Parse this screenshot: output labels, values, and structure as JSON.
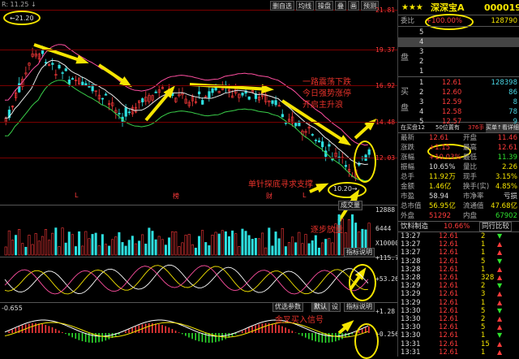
{
  "stock": {
    "stars": "★★★",
    "name": "深深宝A",
    "code": "000019"
  },
  "top_left": {
    "indicator_label": "R: 11.25 ↓",
    "high_marker": "←21.20"
  },
  "toolbar": [
    "删自选",
    "均线",
    "操盘",
    "叠",
    "画",
    "预测"
  ],
  "price_axis": [
    "21.81",
    "19.37",
    "16.92",
    "14.48",
    "12.03"
  ],
  "price_axis_right": [
    "21.81",
    "19.37",
    "16.92",
    "14.48",
    "12.03"
  ],
  "low_marker": "10.20→",
  "chart_tags": [
    "L",
    "榜",
    "财",
    "L"
  ],
  "chart_tools": {
    "composite": "成交量",
    "indicator_help_1": "指标说明",
    "indicator_help_2": "指标说明",
    "optimize": "优选参数",
    "default": "默认",
    "tool3": "设"
  },
  "vol_axis": [
    "12888",
    "6444",
    "X10000"
  ],
  "osc_axis": [
    "+115.7",
    "+53.26",
    "-9.213"
  ],
  "macd_axis": [
    "+1.28",
    "+0.256"
  ],
  "macd_left": "-0.655",
  "annotations": {
    "a1": "一路震荡下跌",
    "a2": "今日强势涨停",
    "a3": "开启主升浪",
    "a4": "单针探底寻求支撑",
    "a5": "逐步放量",
    "a6": "金叉买入信号"
  },
  "panel": {
    "weibi": {
      "label": "委比",
      "value": "+100.00%",
      "vol": "128790"
    },
    "sell": [
      {
        "n": "5",
        "p": "",
        "v": ""
      },
      {
        "n": "4",
        "p": "",
        "v": ""
      },
      {
        "n": "3",
        "p": "",
        "v": ""
      },
      {
        "n": "2",
        "p": "",
        "v": ""
      },
      {
        "n": "1",
        "p": "",
        "v": ""
      }
    ],
    "sell_side_label": [
      "卖",
      "盘"
    ],
    "buy": [
      {
        "n": "1",
        "p": "12.61",
        "v": "128398"
      },
      {
        "n": "2",
        "p": "12.60",
        "v": "86"
      },
      {
        "n": "3",
        "p": "12.59",
        "v": "8"
      },
      {
        "n": "4",
        "p": "12.58",
        "v": "78"
      },
      {
        "n": "5",
        "p": "12.57",
        "v": "9"
      }
    ],
    "buy_side_label": [
      "买",
      "盘"
    ],
    "tabs": {
      "t1": "在买盘12",
      "t2": "50位置有",
      "t3": "376手",
      "t4": "买单↑看详细"
    },
    "stats_left": [
      {
        "label": "最新",
        "value": "12.61"
      },
      {
        "label": "涨跌",
        "value": "+1.15"
      },
      {
        "label": "涨幅",
        "value": "+10.03%"
      },
      {
        "label": "振幅",
        "value": "10.65%"
      },
      {
        "label": "总手",
        "value": "11.92万"
      },
      {
        "label": "金额",
        "value": "1.46亿"
      },
      {
        "label": "市盈",
        "value": "58.94"
      },
      {
        "label": "总市值",
        "value": "56.95亿"
      },
      {
        "label": "外盘",
        "value": "51292"
      }
    ],
    "stats_right": [
      {
        "label": "开盘",
        "value": "11.46"
      },
      {
        "label": "最高",
        "value": "12.61"
      },
      {
        "label": "最低",
        "value": "11.39"
      },
      {
        "label": "量比",
        "value": "2.26"
      },
      {
        "label": "现手",
        "value": "3.15%"
      },
      {
        "label": "换手(实)",
        "value": "4.85%"
      },
      {
        "label": "市净率",
        "value": "亏损"
      },
      {
        "label": "流通值",
        "value": "47.68亿"
      },
      {
        "label": "内盘",
        "value": "67902"
      }
    ],
    "bottom_tabs": [
      "分价",
      "分时",
      "相关",
      "同行比较"
    ],
    "bottom_tab_labels": {
      "t1": "饮料制造",
      "t2": "10.66%",
      "t3": "同行比较"
    },
    "ticks": [
      {
        "t": "13:27",
        "p": "12.61",
        "v": "2"
      },
      {
        "t": "13:27",
        "p": "12.61",
        "v": "1"
      },
      {
        "t": "13:27",
        "p": "12.61",
        "v": "1"
      },
      {
        "t": "13:28",
        "p": "12.61",
        "v": "5"
      },
      {
        "t": "13:28",
        "p": "12.61",
        "v": "1"
      },
      {
        "t": "13:28",
        "p": "12.61",
        "v": "328"
      },
      {
        "t": "13:29",
        "p": "12.61",
        "v": "2"
      },
      {
        "t": "13:29",
        "p": "12.61",
        "v": "3"
      },
      {
        "t": "13:29",
        "p": "12.61",
        "v": "1"
      },
      {
        "t": "13:30",
        "p": "12.61",
        "v": "5"
      },
      {
        "t": "13:30",
        "p": "12.61",
        "v": "2"
      },
      {
        "t": "13:30",
        "p": "12.61",
        "v": "5"
      },
      {
        "t": "13:30",
        "p": "12.61",
        "v": "1"
      },
      {
        "t": "13:31",
        "p": "12.61",
        "v": "15"
      },
      {
        "t": "13:31",
        "p": "12.61",
        "v": "1"
      }
    ]
  },
  "colors": {
    "up": "#ff3b3b",
    "down": "#2ee02e",
    "accent": "#f5e500",
    "grid": "#7a0000",
    "cyan": "#49d7e6"
  }
}
